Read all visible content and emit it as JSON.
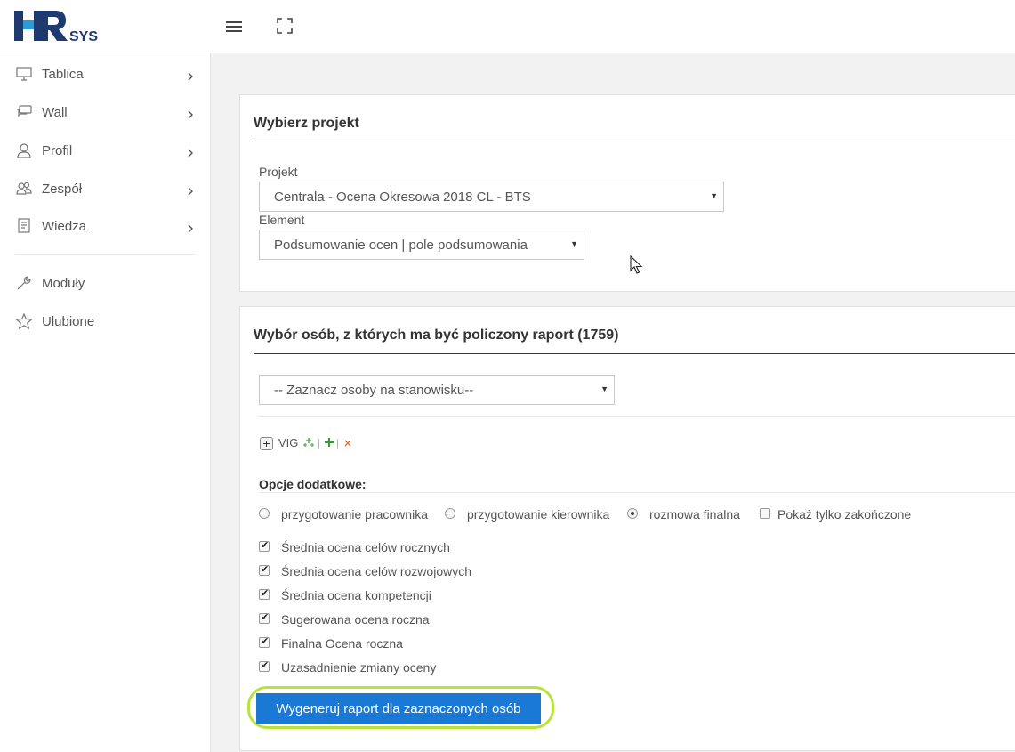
{
  "header": {
    "logo_text": "HRsys",
    "menu_icon": "hamburger-icon",
    "fullscreen_icon": "fullscreen-icon"
  },
  "sidebar": {
    "items": [
      {
        "label": "Tablica",
        "icon": "monitor-icon",
        "has_submenu": true
      },
      {
        "label": "Wall",
        "icon": "chat-icon",
        "has_submenu": true
      },
      {
        "label": "Profil",
        "icon": "user-icon",
        "has_submenu": true
      },
      {
        "label": "Zespół",
        "icon": "team-icon",
        "has_submenu": true
      },
      {
        "label": "Wiedza",
        "icon": "book-icon",
        "has_submenu": true
      }
    ],
    "secondary_items": [
      {
        "label": "Moduły",
        "icon": "wrench-icon"
      },
      {
        "label": "Ulubione",
        "icon": "star-icon"
      }
    ]
  },
  "project_panel": {
    "title": "Wybierz projekt",
    "project_label": "Projekt",
    "project_value": "Centrala - Ocena Okresowa 2018 CL - BTS",
    "element_label": "Element",
    "element_value": "Podsumowanie ocen | pole podsumowania"
  },
  "people_panel": {
    "title": "Wybór osób, z których ma być policzony raport (1759)",
    "position_select": "-- Zaznacz osoby na stanowisku--",
    "tree": {
      "node_label": "VIG",
      "actions": [
        "add-subtree-icon",
        "add-icon",
        "remove-icon"
      ]
    },
    "options_label": "Opcje dodatkowe:",
    "radio_options": [
      {
        "label": "przygotowanie pracownika",
        "checked": false
      },
      {
        "label": "przygotowanie kierownika",
        "checked": false
      },
      {
        "label": "rozmowa finalna",
        "checked": true
      }
    ],
    "show_finished": {
      "label": "Pokaż tylko zakończone",
      "checked": false
    },
    "checkboxes": [
      {
        "label": "Średnia ocena celów rocznych",
        "checked": true
      },
      {
        "label": "Średnia ocena celów rozwojowych",
        "checked": true
      },
      {
        "label": "Średnia ocena kompetencji",
        "checked": true
      },
      {
        "label": "Sugerowana ocena roczna",
        "checked": true
      },
      {
        "label": "Finalna Ocena roczna",
        "checked": true
      },
      {
        "label": "Uzasadnienie zmiany oceny",
        "checked": true
      }
    ],
    "generate_button": "Wygeneruj raport dla zaznaczonych osób"
  },
  "colors": {
    "logo_dark": "#1f3a6e",
    "logo_light": "#2a9bd7",
    "primary_button": "#1b79d6",
    "highlight_ring": "#b9e23a",
    "panel_rule": "#2b3b5a"
  }
}
